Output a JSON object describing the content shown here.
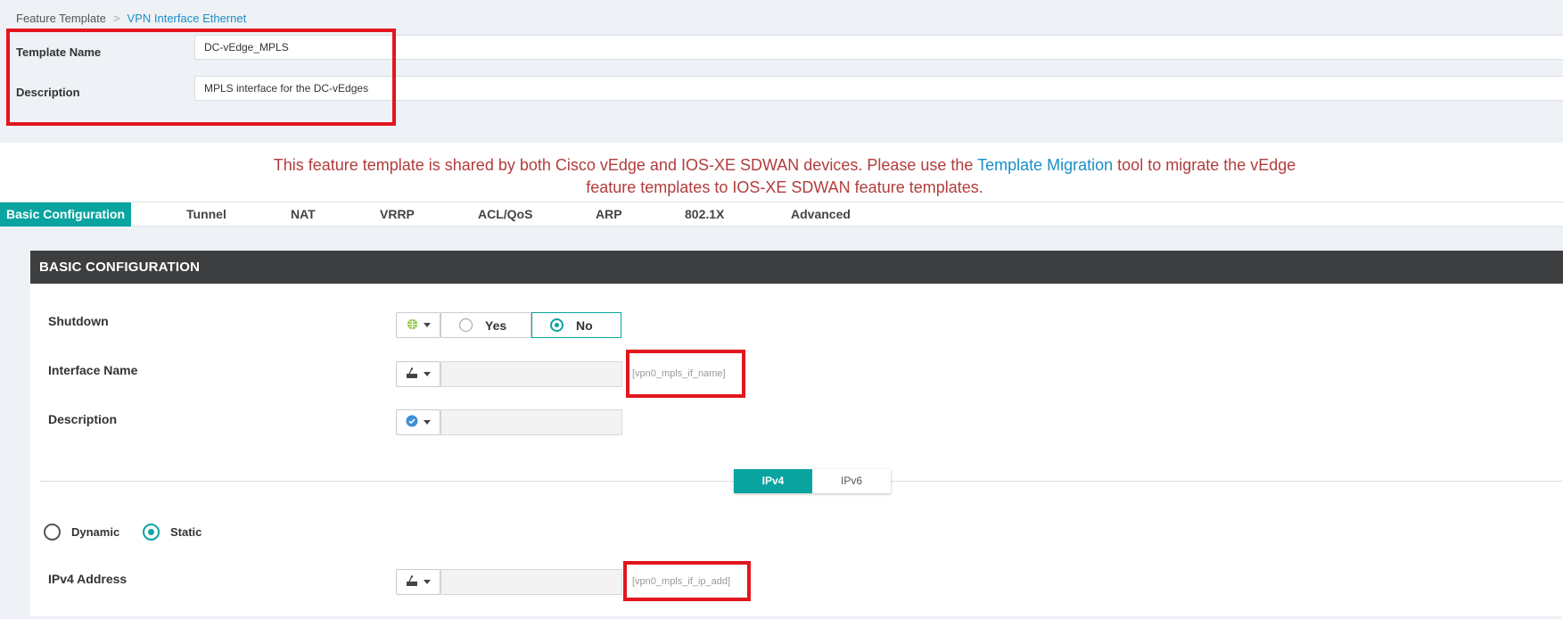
{
  "breadcrumb": {
    "parent": "Feature Template",
    "separator": ">",
    "current": "VPN Interface Ethernet"
  },
  "template": {
    "name_label": "Template Name",
    "name_value": "DC-vEdge_MPLS",
    "description_label": "Description",
    "description_value": "MPLS interface for the DC-vEdges"
  },
  "warning": {
    "before": "This feature template is shared by both Cisco vEdge and IOS-XE SDWAN devices. Please use the ",
    "link": "Template Migration",
    "after": " tool to migrate the vEdge feature templates to IOS-XE SDWAN feature templates."
  },
  "tabs": [
    "Basic Configuration",
    "Tunnel",
    "NAT",
    "VRRP",
    "ACL/QoS",
    "ARP",
    "802.1X",
    "Advanced"
  ],
  "basic": {
    "header": "BASIC CONFIGURATION",
    "shutdown": {
      "label": "Shutdown",
      "scope_icon": "globe-icon",
      "options": [
        "Yes",
        "No"
      ],
      "selected": "No"
    },
    "interface_name": {
      "label": "Interface Name",
      "scope_icon": "device-icon",
      "variable": "[vpn0_mpls_if_name]"
    },
    "description": {
      "label": "Description",
      "scope_icon": "check-circle-icon",
      "value": ""
    },
    "ip_toggle": {
      "options": [
        "IPv4",
        "IPv6"
      ],
      "selected": "IPv4"
    },
    "address_mode": {
      "options": [
        "Dynamic",
        "Static"
      ],
      "selected": "Static"
    },
    "ipv4_address": {
      "label": "IPv4 Address",
      "scope_icon": "device-icon",
      "variable": "[vpn0_mpls_if_ip_add]"
    }
  },
  "colors": {
    "accent": "#0aa4a0",
    "link": "#1a8fc9",
    "warning": "#b23c3c",
    "highlight": "#e3161d",
    "header_bg": "#3d3e40"
  }
}
